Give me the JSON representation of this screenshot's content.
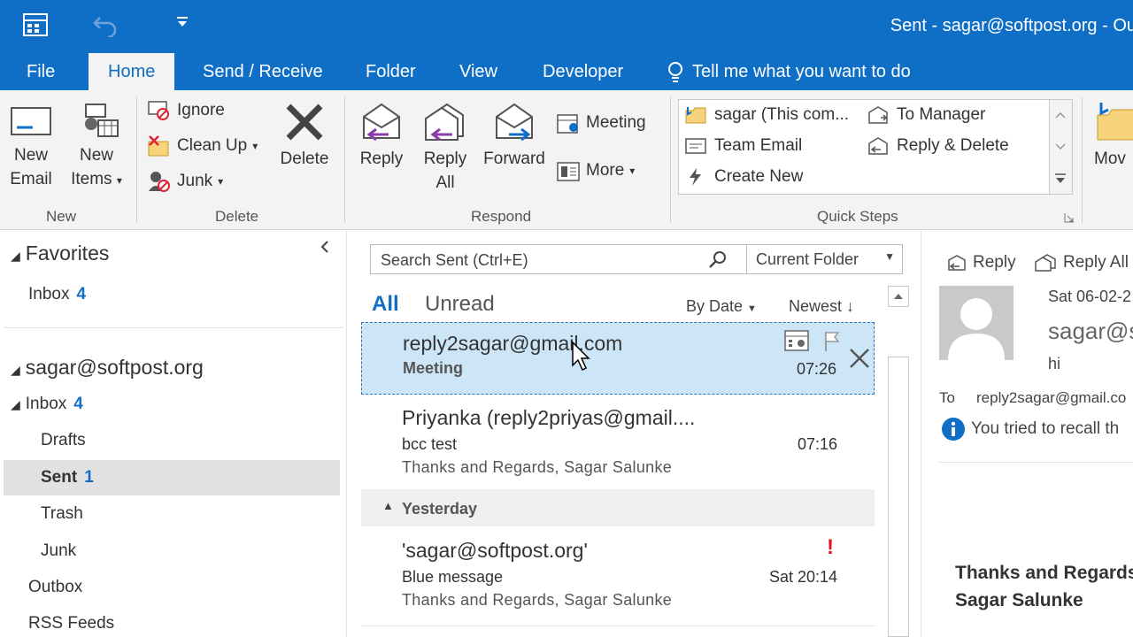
{
  "window": {
    "title": "Sent - sagar@softpost.org - Ou"
  },
  "tabs": [
    {
      "label": "File"
    },
    {
      "label": "Home"
    },
    {
      "label": "Send / Receive"
    },
    {
      "label": "Folder"
    },
    {
      "label": "View"
    },
    {
      "label": "Developer"
    }
  ],
  "tell_me": "Tell me what you want to do",
  "ribbon": {
    "new_group": {
      "label": "New",
      "new_email": "New Email",
      "new_items": "New Items"
    },
    "delete_group": {
      "label": "Delete",
      "ignore": "Ignore",
      "clean_up": "Clean Up",
      "junk": "Junk",
      "delete": "Delete"
    },
    "respond_group": {
      "label": "Respond",
      "reply": "Reply",
      "reply_all": "Reply All",
      "forward": "Forward",
      "meeting": "Meeting",
      "more": "More"
    },
    "quick_steps": {
      "label": "Quick Steps",
      "items": [
        "sagar (This com...",
        "Team Email",
        "Create New",
        "To Manager",
        "Reply & Delete"
      ]
    },
    "move_label": "Mov"
  },
  "folders": {
    "favorites": "Favorites",
    "fav_inbox": {
      "label": "Inbox",
      "count": "4"
    },
    "account": "sagar@softpost.org",
    "inbox": {
      "label": "Inbox",
      "count": "4"
    },
    "drafts": "Drafts",
    "sent": {
      "label": "Sent",
      "count": "1"
    },
    "trash": "Trash",
    "junk": "Junk",
    "outbox": "Outbox",
    "rss": "RSS Feeds"
  },
  "list": {
    "search_placeholder": "Search Sent (Ctrl+E)",
    "scope": "Current Folder",
    "filter_all": "All",
    "filter_unread": "Unread",
    "sort_by": "By Date",
    "order": "Newest",
    "group_yesterday": "Yesterday",
    "messages": [
      {
        "from": "reply2sagar@gmail.com",
        "subject": "Meeting",
        "preview": "",
        "time": "07:26"
      },
      {
        "from": "Priyanka (reply2priyas@gmail....",
        "subject": "bcc test",
        "preview": "Thanks and Regards,  Sagar Salunke",
        "time": "07:16"
      },
      {
        "from": "'sagar@softpost.org'",
        "subject": "Blue message",
        "preview": "Thanks and Regards,  Sagar Salunke",
        "time": "Sat 20:14"
      }
    ]
  },
  "reading": {
    "reply": "Reply",
    "reply_all": "Reply All",
    "date": "Sat 06-02-2",
    "sender": "sagar@s",
    "subject": "hi",
    "to_label": "To",
    "to_value": "reply2sagar@gmail.co",
    "info": "You tried to recall th",
    "sig_line1": "Thanks and Regards",
    "sig_line2": "Sagar Salunke"
  },
  "colors": {
    "accent": "#0f6fc6",
    "selection": "#cde6f7",
    "flag_red": "#e81123"
  }
}
